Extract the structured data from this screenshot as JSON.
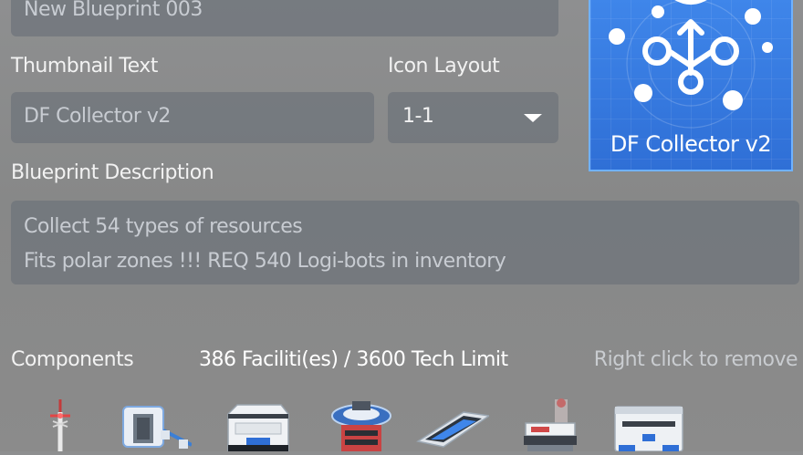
{
  "form": {
    "blueprint_name": "New Blueprint 003",
    "thumbnail_text_label": "Thumbnail Text",
    "thumbnail_text_value": "DF Collector v2",
    "icon_layout_label": "Icon Layout",
    "icon_layout_value": "1-1",
    "description_label": "Blueprint Description",
    "description_lines": [
      "Collect 54 types of resources",
      "Fits polar zones !!! REQ 540 Logi-bots in inventory"
    ]
  },
  "preview": {
    "caption": "DF Collector v2",
    "icon": "collector-hub-icon",
    "accent_color": "#3b82ea"
  },
  "components": {
    "label": "Components",
    "count_text": "386 Faciliti(es) / 3600 Tech Limit",
    "hint": "Right click to remove",
    "items": [
      {
        "icon": "tesla-tower-icon"
      },
      {
        "icon": "logistics-station-icon"
      },
      {
        "icon": "storage-unit-icon"
      },
      {
        "icon": "orbital-collector-icon"
      },
      {
        "icon": "conveyor-belt-icon"
      },
      {
        "icon": "sorter-icon"
      },
      {
        "icon": "storage-chest-icon"
      }
    ]
  }
}
